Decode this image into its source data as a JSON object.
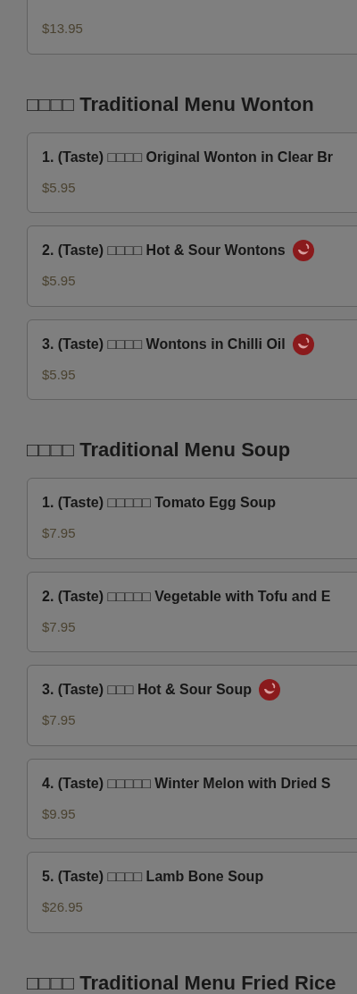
{
  "sections": [
    {
      "items": [
        {
          "price": "$13.95"
        }
      ]
    },
    {
      "heading": "□□□□ Traditional Menu Wonton",
      "items": [
        {
          "name": "1. (Taste) □□□□ Original Wonton in Clear Br",
          "price": "$5.95",
          "spicy": false
        },
        {
          "name": "2. (Taste) □□□□ Hot & Sour Wontons",
          "price": "$5.95",
          "spicy": true
        },
        {
          "name": "3. (Taste) □□□□ Wontons in Chilli Oil",
          "price": "$5.95",
          "spicy": true
        }
      ]
    },
    {
      "heading": "□□□□ Traditional Menu Soup",
      "items": [
        {
          "name": "1. (Taste) □□□□□ Tomato Egg Soup",
          "price": "$7.95",
          "spicy": false
        },
        {
          "name": "2. (Taste) □□□□□ Vegetable with Tofu and E",
          "price": "$7.95",
          "spicy": false
        },
        {
          "name": "3. (Taste) □□□ Hot & Sour Soup",
          "price": "$7.95",
          "spicy": true
        },
        {
          "name": "4. (Taste) □□□□□ Winter Melon with Dried S",
          "price": "$9.95",
          "spicy": false
        },
        {
          "name": "5. (Taste) □□□□ Lamb Bone Soup",
          "price": "$26.95",
          "spicy": false
        }
      ]
    },
    {
      "heading": "□□□□ Traditional Menu Fried Rice"
    }
  ]
}
